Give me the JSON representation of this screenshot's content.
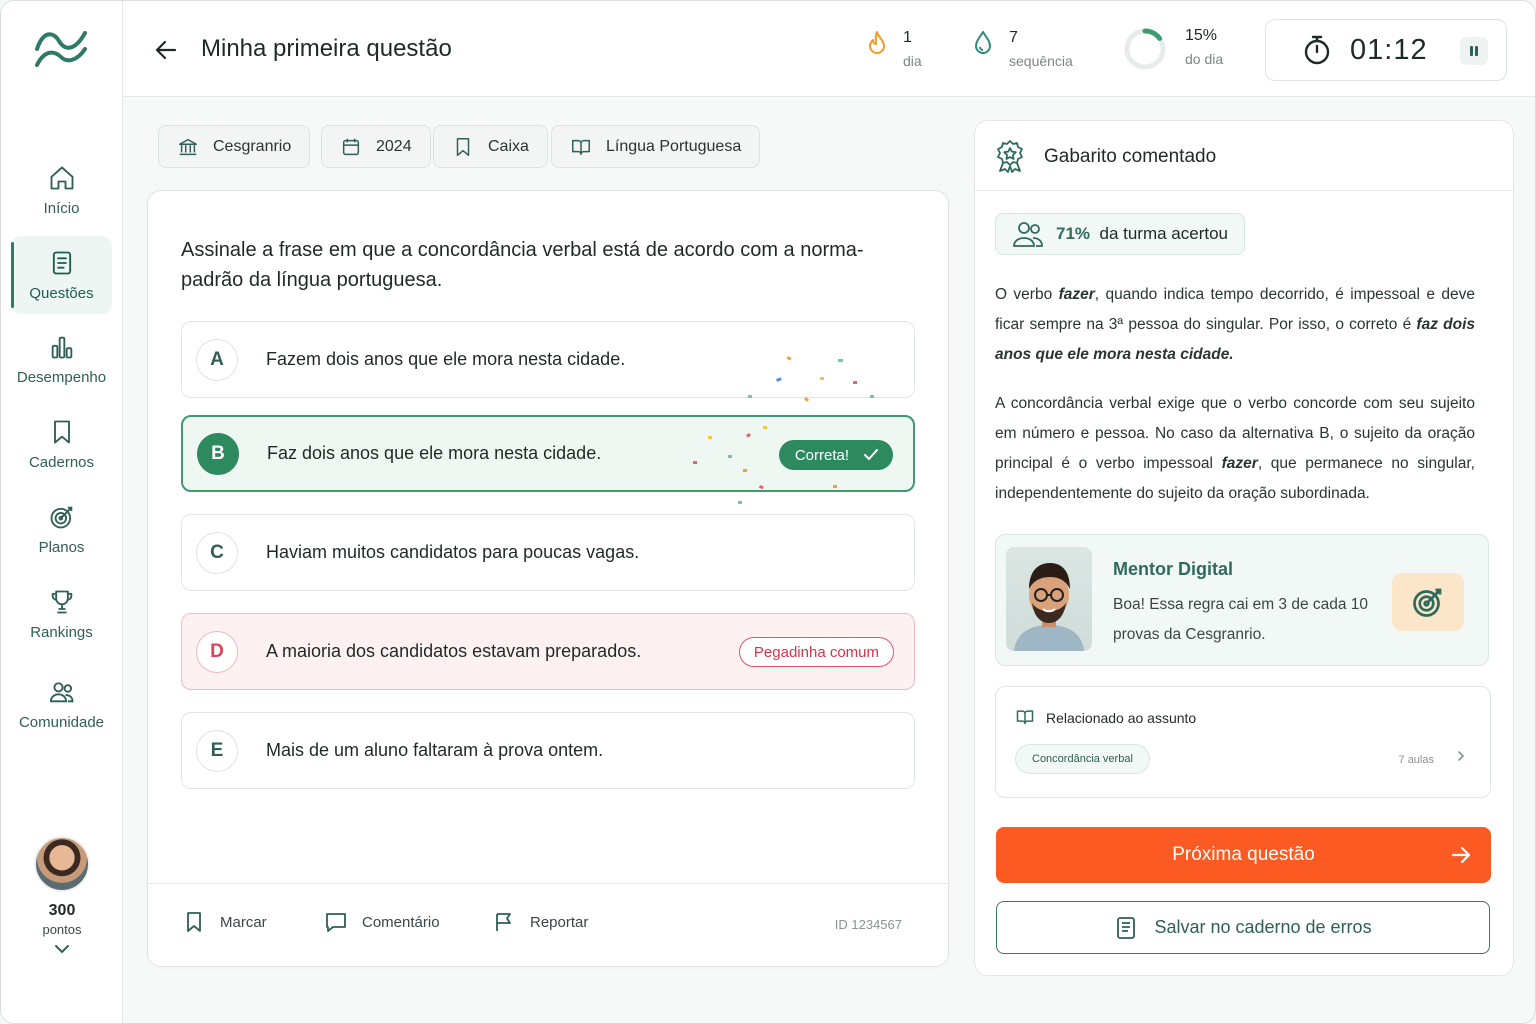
{
  "sidebar": {
    "items": [
      {
        "label": "Início",
        "icon": "home-icon"
      },
      {
        "label": "Questões",
        "icon": "document-icon"
      },
      {
        "label": "Desempenho",
        "icon": "bar-chart-icon"
      },
      {
        "label": "Cadernos",
        "icon": "bookmark-icon"
      },
      {
        "label": "Planos",
        "icon": "target-icon"
      },
      {
        "label": "Rankings",
        "icon": "trophy-icon"
      },
      {
        "label": "Comunidade",
        "icon": "users-icon"
      }
    ],
    "active_index": 1,
    "profile": {
      "points": "300",
      "points_label": "pontos"
    }
  },
  "header": {
    "title": "Minha primeira questão",
    "stats": [
      {
        "value": "1",
        "label": "dia",
        "icon": "flame-icon"
      },
      {
        "value": "7",
        "label": "sequência",
        "icon": "drop-icon"
      },
      {
        "value": "15%",
        "label": "do dia",
        "icon": "progress-ring-icon",
        "progress": 0.15
      }
    ],
    "timer": "01:12"
  },
  "tags": [
    "Cesgranrio",
    "2024",
    "Caixa",
    "Língua Portuguesa"
  ],
  "question": {
    "text": "Assinale a frase em que a concordância verbal está de acordo com a norma-padrão da língua portuguesa.",
    "alternatives": [
      {
        "letter": "A",
        "text": "Fazem dois anos que ele mora nesta cidade."
      },
      {
        "letter": "B",
        "text": "Faz dois anos que ele mora nesta cidade.",
        "badge": "Correta!"
      },
      {
        "letter": "C",
        "text": "Haviam muitos candidatos para poucas vagas."
      },
      {
        "letter": "D",
        "text": "A maioria dos candidatos estavam preparados.",
        "badge": "Pegadinha comum"
      },
      {
        "letter": "E",
        "text": "Mais de um aluno faltaram à prova ontem."
      }
    ],
    "footer": {
      "mark": "Marcar",
      "comment": "Comentário",
      "report": "Reportar",
      "id": "ID 1234567"
    }
  },
  "answer_panel": {
    "title": "Gabarito comentado",
    "pct": "71%",
    "pct_label": "da turma acertou",
    "p1_a": "O verbo ",
    "p1_b": "fazer",
    "p1_c": ", quando indica tempo decorrido, é impessoal e deve ficar sempre na 3ª pessoa do singular. Por isso, o correto é ",
    "p1_d": "faz dois anos que ele mora nesta cidade.",
    "p2_a": "A concordância verbal exige que o verbo concorde com seu sujeito em número e pessoa. No caso da alternativa B, o sujeito da oração principal é o verbo impessoal ",
    "p2_b": "fazer",
    "p2_c": ", que permanece no singular, independentemente do sujeito da oração subordinada.",
    "mentor": {
      "name": "Mentor Digital",
      "message": "Boa! Essa regra cai em 3 de cada 10 provas da Cesgranrio."
    },
    "related": {
      "title": "Relacionado ao assunto",
      "chip": "Concordância verbal",
      "count": "7 aulas"
    },
    "next_button": "Próxima questão",
    "save_button": "Salvar no caderno de erros"
  },
  "colors": {
    "accent": "#2f6b5c",
    "correct": "#2c8a5e",
    "trap": "#d5344b",
    "cta": "#fb5a22"
  }
}
